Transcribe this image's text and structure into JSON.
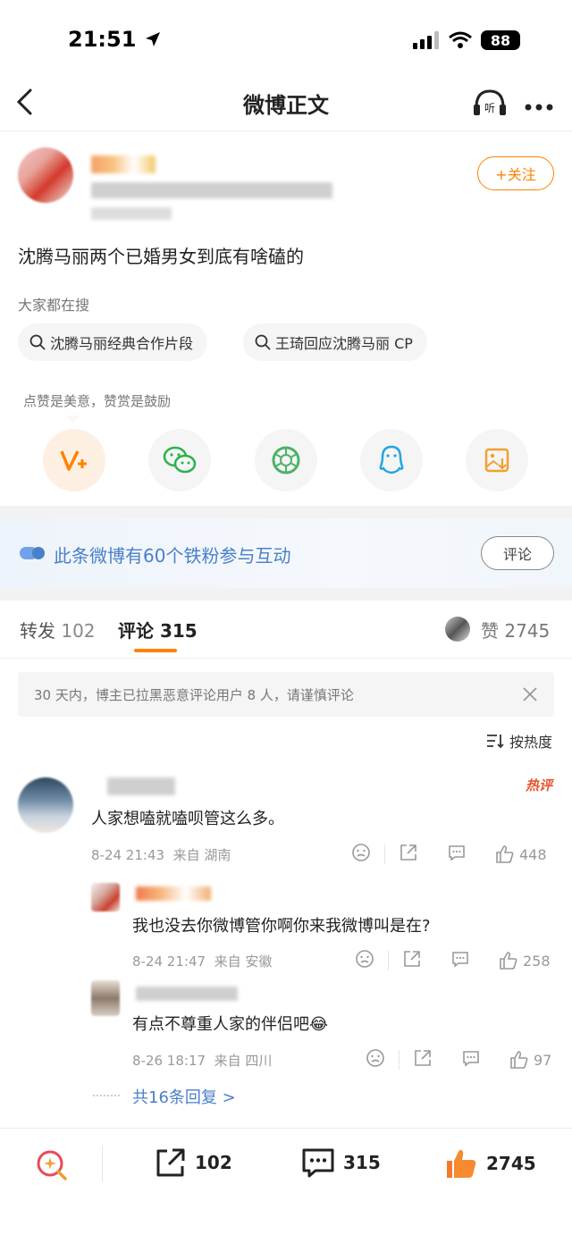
{
  "status_bar": {
    "time": "21:51",
    "battery": "88"
  },
  "nav": {
    "title": "微博正文"
  },
  "post": {
    "follow_label": "+关注",
    "text": "沈腾马丽两个已婚男女到底有啥磕的",
    "hot_search_label": "大家都在搜",
    "chips": [
      "沈腾马丽经典合作片段",
      "王琦回应沈腾马丽 CP"
    ]
  },
  "reward_tip": "点赞是美意，赞赏是鼓励",
  "share_icons": [
    "v-plus-icon",
    "wechat-icon",
    "moments-icon",
    "qq-icon",
    "save-image-icon"
  ],
  "fans_banner": {
    "text": "此条微博有60个铁粉参与互动",
    "button": "评论"
  },
  "tabs": {
    "repost_label": "转发",
    "repost_count": "102",
    "comment_label": "评论",
    "comment_count": "315",
    "like_label": "赞",
    "like_count": "2745"
  },
  "notice": "30 天内，博主已拉黑恶意评论用户 8 人，请谨慎评论",
  "sort_label": "按热度",
  "comment": {
    "hot_tag": "热评",
    "text": "人家想嗑就嗑呗管这么多。",
    "time": "8-24 21:43",
    "source": "来自 湖南",
    "likes": "448",
    "replies": [
      {
        "text": "我也没去你微博管你啊你来我微博叫是在?",
        "time": "8-24 21:47",
        "source": "来自 安徽",
        "likes": "258"
      },
      {
        "text": "有点不尊重人家的伴侣吧😂",
        "time": "8-26 18:17",
        "source": "来自 四川",
        "likes": "97"
      }
    ],
    "more_replies": "共16条回复 >"
  },
  "bottom_bar": {
    "repost": "102",
    "comment": "315",
    "like": "2745"
  },
  "colors": {
    "accent": "#ff8200",
    "link": "#4a7fc9"
  }
}
